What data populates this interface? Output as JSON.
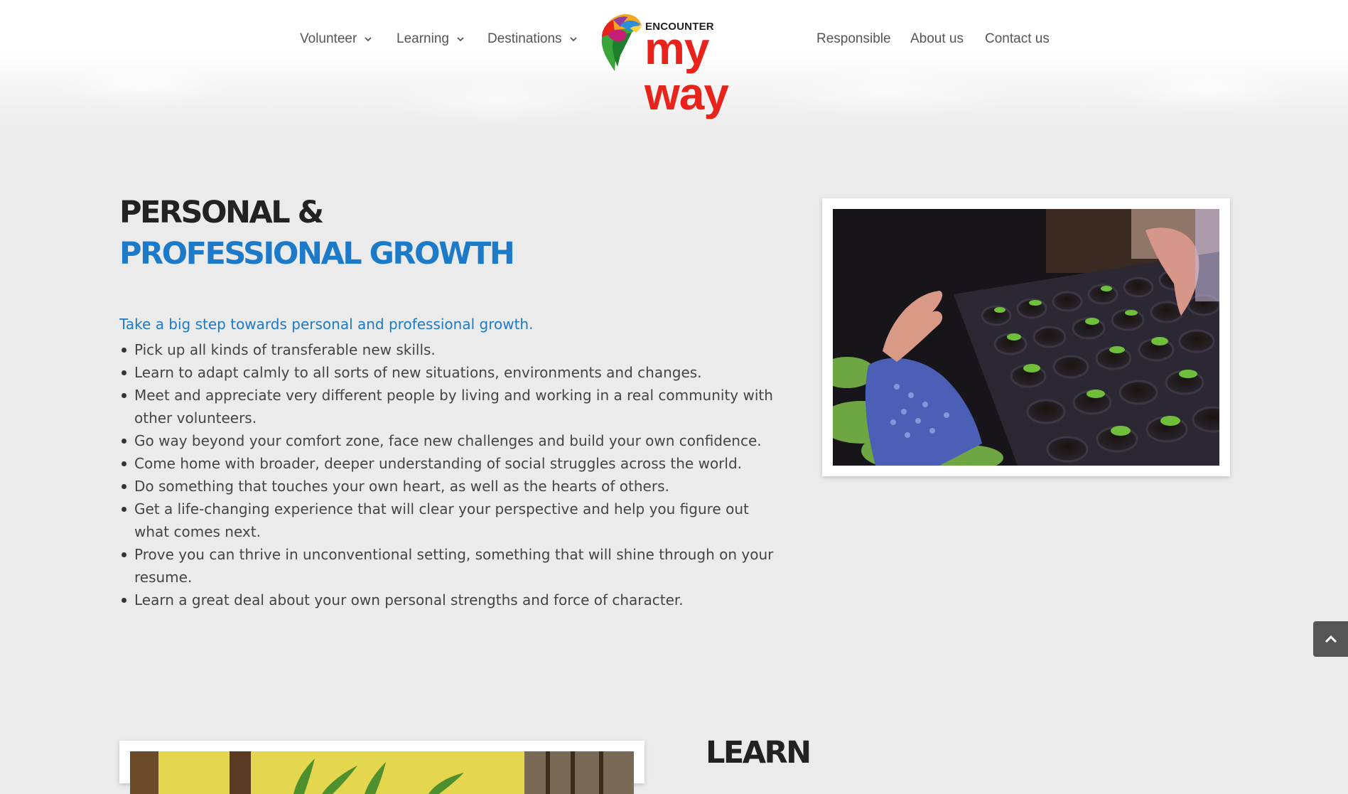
{
  "nav": {
    "left_items": [
      {
        "label": "Volunteer",
        "has_dropdown": true
      },
      {
        "label": "Learning",
        "has_dropdown": true
      },
      {
        "label": "Destinations",
        "has_dropdown": true
      }
    ],
    "right_items": [
      {
        "label": "Responsible"
      },
      {
        "label": "About us"
      },
      {
        "label": "Contact us"
      }
    ]
  },
  "logo": {
    "top_text": "ENCOUNTER",
    "main_text": "my way",
    "brand_color": "#e8231c"
  },
  "section1": {
    "heading_line1": "PERSONAL &",
    "heading_line2": "PROFESSIONAL GROWTH",
    "intro": "Take a big step towards personal and professional growth.",
    "bullets": [
      "Pick up all kinds of transferable new skills.",
      "Learn to adapt calmly to all sorts of new situations, environments and changes.",
      "Meet and appreciate very different people by living and working in a real community with other volunteers.",
      "Go way beyond your comfort zone, face new challenges and build your own confidence.",
      "Come home with broader, deeper understanding of social struggles across the world.",
      "Do something that touches your own heart, as well as the hearts of others.",
      "Get a life-changing experience that will clear your perspective and help you figure out what comes next.",
      "Prove you can thrive in unconventional setting, something that will shine through on your resume.",
      "Learn a great deal about your own personal strengths and force of character."
    ]
  },
  "section2": {
    "heading": "LEARN"
  },
  "colors": {
    "accent_blue": "#1c7ac8",
    "heading_dark": "#222222",
    "page_bg": "#ebebeb"
  },
  "icons": {
    "dropdown": "chevron-down-icon",
    "back_to_top": "chevron-up-icon"
  }
}
